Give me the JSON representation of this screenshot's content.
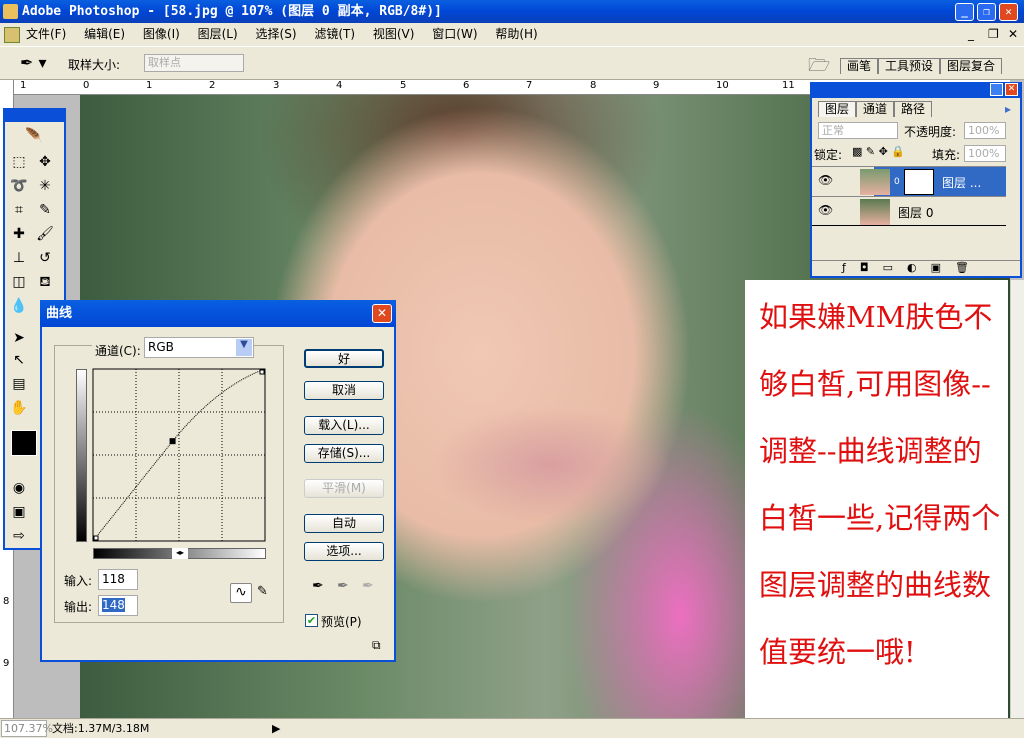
{
  "window": {
    "title": "Adobe Photoshop - [58.jpg @ 107% (图层 0 副本, RGB/8#)]",
    "min": "_",
    "restore": "❐",
    "close": "✕"
  },
  "menu": [
    "文件(F)",
    "编辑(E)",
    "图像(I)",
    "图层(L)",
    "选择(S)",
    "滤镜(T)",
    "视图(V)",
    "窗口(W)",
    "帮助(H)"
  ],
  "doc_controls": [
    "_",
    "❐",
    "✕"
  ],
  "options": {
    "sample_size_label": "取样大小:",
    "sample_size_value": "取样点"
  },
  "palette_well": {
    "tabs": [
      "画笔",
      "工具预设",
      "图层复合"
    ]
  },
  "rulers": {
    "h": [
      "1",
      "0",
      "1",
      "2",
      "3",
      "4",
      "5",
      "6",
      "7",
      "8",
      "9",
      "10",
      "11"
    ],
    "v": [
      "8",
      "9"
    ]
  },
  "layers_panel": {
    "tabs": [
      "图层",
      "通道",
      "路径"
    ],
    "blend_mode": "正常",
    "opacity_label": "不透明度:",
    "opacity": "100%",
    "lock_label": "锁定:",
    "fill_label": "填充:",
    "fill": "100%",
    "layers": [
      {
        "name": "图层 ...",
        "selected": true
      },
      {
        "name": "图层 0",
        "selected": false
      }
    ]
  },
  "curves": {
    "title": "曲线",
    "channel_label": "通道(C):",
    "channel": "RGB",
    "input_label": "输入:",
    "input": "118",
    "output_label": "输出:",
    "output": "148",
    "buttons": {
      "ok": "好",
      "cancel": "取消",
      "load": "载入(L)...",
      "save": "存储(S)...",
      "smooth": "平滑(M)",
      "auto": "自动",
      "options": "选项..."
    },
    "preview_label": "预览(P)",
    "preview_checked": true
  },
  "note": {
    "lines": [
      "如果嫌MM肤色不",
      "够白皙,可用图像--",
      "调整--曲线调整的",
      "白皙一些,记得两个",
      "图层调整的曲线数",
      "值要统一哦!"
    ],
    "color": "#e01010"
  },
  "status": {
    "zoom": "107.37%",
    "doc": "文档:1.37M/3.18M"
  }
}
